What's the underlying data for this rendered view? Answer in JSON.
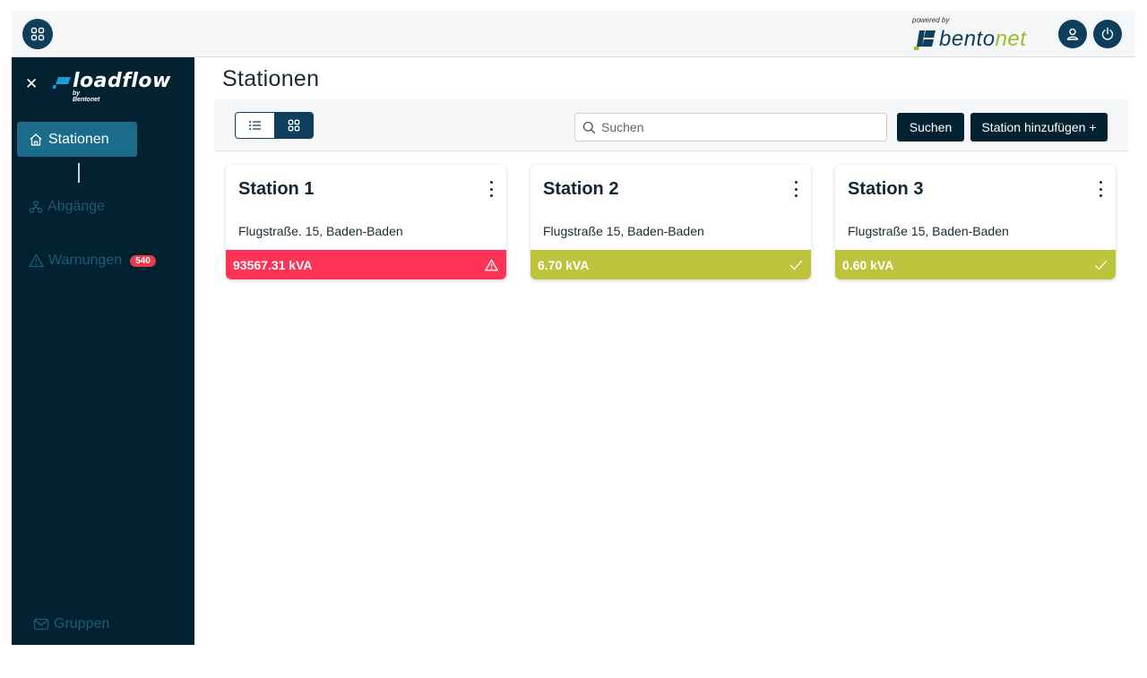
{
  "topbar": {
    "apps_icon": "grid-icon",
    "powered_by": "powered by",
    "brand_main": "bento",
    "brand_accent": "net",
    "user_icon": "user-icon",
    "power_icon": "power-icon"
  },
  "sidebar": {
    "logo_word": "loadflow",
    "logo_sub": "by Bentonet",
    "items": [
      {
        "label": "Stationen",
        "icon": "home-icon",
        "active": true
      },
      {
        "label": "Abgänge",
        "icon": "network-icon",
        "active": false
      },
      {
        "label": "Warnungen",
        "icon": "warning-icon",
        "active": false,
        "badge": "540"
      },
      {
        "label": "Gruppen",
        "icon": "mail-icon",
        "active": false
      }
    ]
  },
  "main": {
    "title": "Stationen",
    "search": {
      "placeholder": "Suchen"
    },
    "search_button": "Suchen",
    "add_button": "Station hinzufügen +",
    "view_mode": "grid"
  },
  "stations": [
    {
      "name": "Station 1",
      "address": "Flugstraße. 15, Baden-Baden",
      "load": "93567.31 kVA",
      "status": "warning",
      "status_color": "#ff3357"
    },
    {
      "name": "Station 2",
      "address": "Flugstraße 15, Baden-Baden",
      "load": "6.70 kVA",
      "status": "ok",
      "status_color": "#bdc43c"
    },
    {
      "name": "Station 3",
      "address": "Flugstraße 15, Baden-Baden",
      "load": "0.60 kVA",
      "status": "ok",
      "status_color": "#bdc43c"
    }
  ],
  "colors": {
    "primary_dark": "#032231",
    "primary": "#0d3f5c",
    "active_nav": "#1b6c8a",
    "accent_green": "#9fbc2e",
    "alert_red": "#ff3357"
  }
}
